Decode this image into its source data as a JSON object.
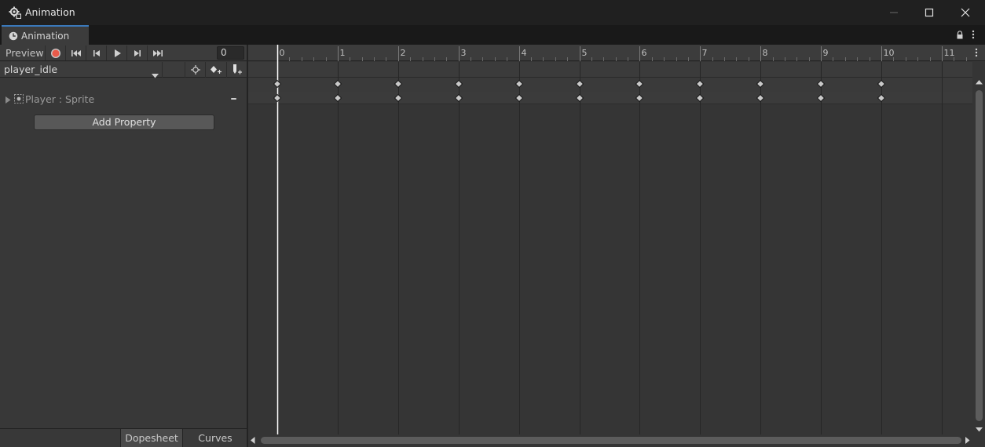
{
  "window": {
    "title": "Animation",
    "tab_label": "Animation",
    "icons": [
      "unity-cog-icon",
      "minimize-icon",
      "maximize-icon",
      "close-icon",
      "lock-icon",
      "kebab-menu-icon"
    ]
  },
  "toolbar": {
    "preview_label": "Preview",
    "frame_value": "0",
    "buttons": [
      "record-icon",
      "first-key-icon",
      "prev-key-icon",
      "play-icon",
      "next-key-icon",
      "last-key-icon"
    ]
  },
  "clip": {
    "selected": "player_idle",
    "buttons": [
      "filter-by-selection-icon",
      "add-keyframe-icon",
      "add-event-icon"
    ]
  },
  "hierarchy": {
    "properties": [
      {
        "label": "Player : Sprite",
        "expanded": false
      }
    ],
    "add_property_label": "Add Property"
  },
  "view_tabs": {
    "dopesheet_label": "Dopesheet",
    "curves_label": "Curves",
    "active": "Dopesheet"
  },
  "timeline": {
    "ruler_labels": [
      "0",
      "1",
      "2",
      "3",
      "4",
      "5",
      "6",
      "7",
      "8",
      "9",
      "10",
      "11"
    ],
    "playhead_frame": 0,
    "keyframes": [
      0,
      1,
      2,
      3,
      4,
      5,
      6,
      7,
      8,
      9,
      10
    ],
    "colors": {
      "playhead": "#ffffff",
      "keyframe": "#c8c8c8",
      "grid_line": "#262626"
    }
  }
}
